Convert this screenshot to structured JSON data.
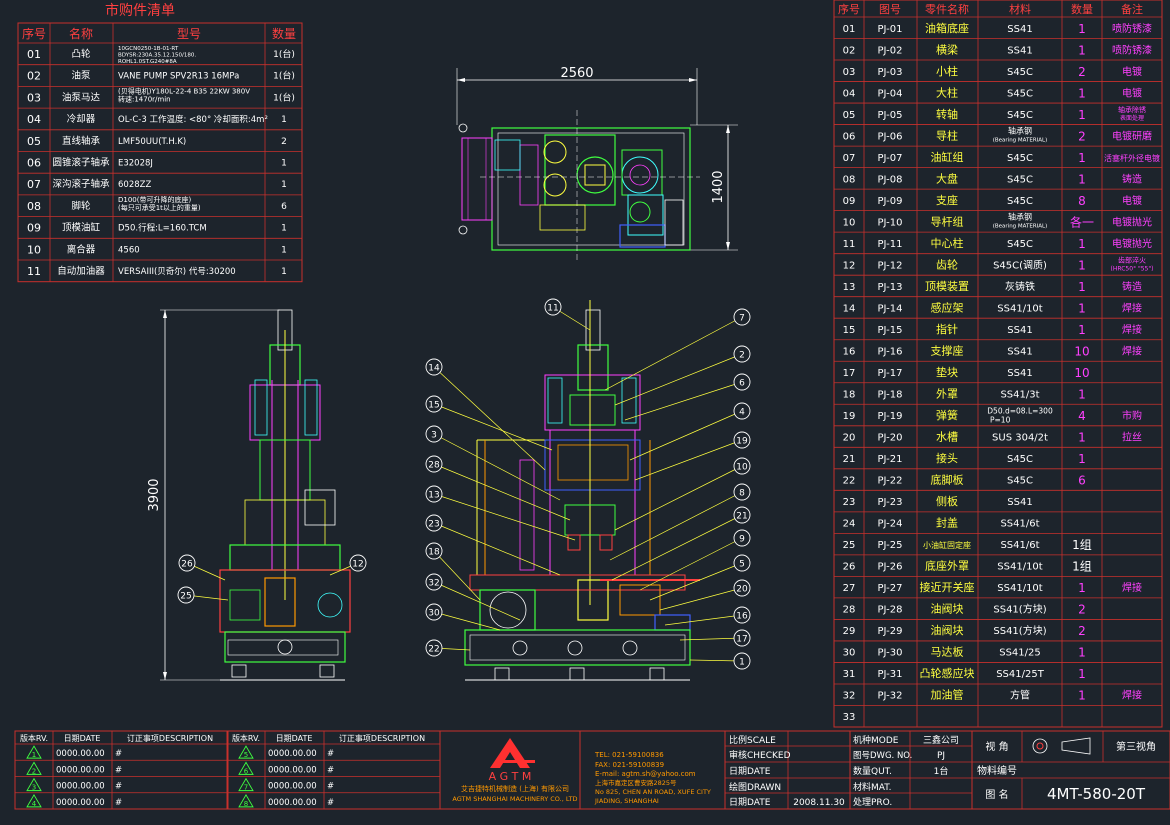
{
  "colors": {
    "bg": "#1d242c",
    "grid": "#c8302c",
    "text": "#ffffff",
    "accent_red": "#ff4040",
    "magenta": "#ff40ff",
    "yellow": "#ffff40",
    "cyan": "#40ffff",
    "green": "#40ff40",
    "blue": "#4060ff",
    "orange": "#ff9900"
  },
  "purchased_list": {
    "title": "市购件清单",
    "headers": [
      "序号",
      "名称",
      "型号",
      "数量"
    ],
    "rows": [
      {
        "no": "01",
        "name": "凸轮",
        "model": "10GCN0250-1B-01-RT / BDYSR:230A.35.12.150/180. / ROHL1.0ST.G240#8A",
        "qty": "1(台)"
      },
      {
        "no": "02",
        "name": "油泵",
        "model": "VANE PUMP  SPV2R13  16MPa",
        "qty": "1(台)"
      },
      {
        "no": "03",
        "name": "油泵马达",
        "model": "(贝得电机)Y180L-22-4 B35 22KW 380V / 转速:1470r/min",
        "qty": "1(台)"
      },
      {
        "no": "04",
        "name": "冷却器",
        "model": "OL-C-3 工作温度: <80°  冷却面积:4m²",
        "qty": "1"
      },
      {
        "no": "05",
        "name": "直线轴承",
        "model": "LMF50UU(T.H.K)",
        "qty": "2"
      },
      {
        "no": "06",
        "name": "圆锥滚子轴承",
        "model": "E32028J",
        "qty": "1"
      },
      {
        "no": "07",
        "name": "深沟滚子轴承",
        "model": "6028ZZ",
        "qty": "1"
      },
      {
        "no": "08",
        "name": "脚轮",
        "model": "D100(带可升降的底座) / (每只可承受1t以上的重量)",
        "qty": "6"
      },
      {
        "no": "09",
        "name": "顶模油缸",
        "model": "D50.行程:L=160.TCM",
        "qty": "1"
      },
      {
        "no": "10",
        "name": "离合器",
        "model": "4560",
        "qty": "1"
      },
      {
        "no": "11",
        "name": "自动加油器",
        "model": "VERSAIII(贝奇尔) 代号:30200",
        "qty": "1"
      }
    ]
  },
  "parts_list": {
    "headers": [
      "序号",
      "图号",
      "零件名称",
      "材料",
      "数量",
      "备注"
    ],
    "rows": [
      {
        "no": "01",
        "code": "PJ-01",
        "name": "油箱底座",
        "mat": "SS41",
        "qty": "1",
        "note": "喷防锈漆"
      },
      {
        "no": "02",
        "code": "PJ-02",
        "name": "横梁",
        "mat": "SS41",
        "qty": "1",
        "note": "喷防锈漆"
      },
      {
        "no": "03",
        "code": "PJ-03",
        "name": "小柱",
        "mat": "S45C",
        "qty": "2",
        "note": "电镀"
      },
      {
        "no": "04",
        "code": "PJ-04",
        "name": "大柱",
        "mat": "S45C",
        "qty": "1",
        "note": "电镀"
      },
      {
        "no": "05",
        "code": "PJ-05",
        "name": "转轴",
        "mat": "S45C",
        "qty": "1",
        "note": "轴承除锈 表面处理"
      },
      {
        "no": "06",
        "code": "PJ-06",
        "name": "导柱",
        "mat": "轴承钢 (Bearing MATERIAL)",
        "qty": "2",
        "note": "电镀研磨"
      },
      {
        "no": "07",
        "code": "PJ-07",
        "name": "油缸组",
        "mat": "S45C",
        "qty": "1",
        "note": "活塞杆外径电镀"
      },
      {
        "no": "08",
        "code": "PJ-08",
        "name": "大盘",
        "mat": "S45C",
        "qty": "1",
        "note": "铸造"
      },
      {
        "no": "09",
        "code": "PJ-09",
        "name": "支座",
        "mat": "S45C",
        "qty": "8",
        "note": "电镀"
      },
      {
        "no": "10",
        "code": "PJ-10",
        "name": "导杆组",
        "mat": "轴承钢 (Bearing MATERIAL)",
        "qty": "各一",
        "note": "电镀抛光"
      },
      {
        "no": "11",
        "code": "PJ-11",
        "name": "中心柱",
        "mat": "S45C",
        "qty": "1",
        "note": "电镀抛光"
      },
      {
        "no": "12",
        "code": "PJ-12",
        "name": "齿轮",
        "mat": "S45C(调质)",
        "qty": "1",
        "note": "齿部淬火 (HRC50° \"55\")"
      },
      {
        "no": "13",
        "code": "PJ-13",
        "name": "顶模装置",
        "mat": "灰铸铁",
        "qty": "1",
        "note": "铸造"
      },
      {
        "no": "14",
        "code": "PJ-14",
        "name": "感应架",
        "mat": "SS41/10t",
        "qty": "1",
        "note": "焊接"
      },
      {
        "no": "15",
        "code": "PJ-15",
        "name": "指针",
        "mat": "SS41",
        "qty": "1",
        "note": "焊接"
      },
      {
        "no": "16",
        "code": "PJ-16",
        "name": "支撑座",
        "mat": "SS41",
        "qty": "10",
        "note": "焊接"
      },
      {
        "no": "17",
        "code": "PJ-17",
        "name": "垫块",
        "mat": "SS41",
        "qty": "10",
        "note": ""
      },
      {
        "no": "18",
        "code": "PJ-18",
        "name": "外罩",
        "mat": "SS41/3t",
        "qty": "1",
        "note": ""
      },
      {
        "no": "19",
        "code": "PJ-19",
        "name": "弹簧",
        "mat": "D50.d=08.L=300 P=10",
        "qty": "4",
        "note": "市购"
      },
      {
        "no": "20",
        "code": "PJ-20",
        "name": "水槽",
        "mat": "SUS 304/2t",
        "qty": "1",
        "note": "拉丝"
      },
      {
        "no": "21",
        "code": "PJ-21",
        "name": "接头",
        "mat": "S45C",
        "qty": "1",
        "note": ""
      },
      {
        "no": "22",
        "code": "PJ-22",
        "name": "底脚板",
        "mat": "S45C",
        "qty": "6",
        "note": ""
      },
      {
        "no": "23",
        "code": "PJ-23",
        "name": "侧板",
        "mat": "SS41",
        "qty": "",
        "note": ""
      },
      {
        "no": "24",
        "code": "PJ-24",
        "name": "封盖",
        "mat": "SS41/6t",
        "qty": "",
        "note": ""
      },
      {
        "no": "25",
        "code": "PJ-25",
        "name": "小油缸固定座",
        "mat": "SS41/6t",
        "qty": "1组",
        "note": ""
      },
      {
        "no": "26",
        "code": "PJ-26",
        "name": "底座外罩",
        "mat": "SS41/10t",
        "qty": "1组",
        "note": ""
      },
      {
        "no": "27",
        "code": "PJ-27",
        "name": "接近开关座",
        "mat": "SS41/10t",
        "qty": "1",
        "note": "焊接"
      },
      {
        "no": "28",
        "code": "PJ-28",
        "name": "油阀块",
        "mat": "SS41(方块)",
        "qty": "2",
        "note": ""
      },
      {
        "no": "29",
        "code": "PJ-29",
        "name": "油阀块",
        "mat": "SS41(方块)",
        "qty": "2",
        "note": ""
      },
      {
        "no": "30",
        "code": "PJ-30",
        "name": "马达板",
        "mat": "SS41/25",
        "qty": "1",
        "note": ""
      },
      {
        "no": "31",
        "code": "PJ-31",
        "name": "凸轮感应块",
        "mat": "SS41/25T",
        "qty": "1",
        "note": ""
      },
      {
        "no": "32",
        "code": "PJ-32",
        "name": "加油管",
        "mat": "方管",
        "qty": "1",
        "note": "焊接"
      },
      {
        "no": "33",
        "code": "",
        "name": "",
        "mat": "",
        "qty": "",
        "note": ""
      }
    ]
  },
  "dimensions": {
    "width": "2560",
    "depth": "1400",
    "height": "3900"
  },
  "balloons": {
    "side_view": [
      "26",
      "25",
      "12"
    ],
    "front_view": [
      "11",
      "7",
      "14",
      "2",
      "15",
      "6",
      "3",
      "4",
      "28",
      "19",
      "13",
      "10",
      "23",
      "8",
      "18",
      "21",
      "32",
      "9",
      "30",
      "5",
      "22",
      "20",
      "16",
      "17",
      "1"
    ]
  },
  "revision_block": {
    "headers": [
      "版本RV.",
      "日期DATE",
      "订正事项DESCRIPTION"
    ],
    "rows": [
      {
        "rev": "1",
        "date": "0000.00.00",
        "desc": "#"
      },
      {
        "rev": "2",
        "date": "0000.00.00",
        "desc": "#"
      },
      {
        "rev": "3",
        "date": "0000.00.00",
        "desc": "#"
      },
      {
        "rev": "4",
        "date": "0000.00.00",
        "desc": "#"
      }
    ],
    "rows_right": [
      {
        "rev": "5",
        "date": "0000.00.00",
        "desc": "#"
      },
      {
        "rev": "6",
        "date": "0000.00.00",
        "desc": "#"
      },
      {
        "rev": "7",
        "date": "0000.00.00",
        "desc": "#"
      },
      {
        "rev": "8",
        "date": "0000.00.00",
        "desc": "#"
      }
    ]
  },
  "company": {
    "logo_text": "A G T M",
    "name_cn": "艾吉捷特机械制造 (上海) 有限公司",
    "name_en": "AGTM SHANGHAI MACHINERY CO., LTD",
    "tel": "TEL: 021-59100836",
    "fax": "FAX: 021-59100839",
    "email": "E-mail: agtm.sh@yahoo.com",
    "addr_cn": "上海市嘉定区曹安路2825号",
    "addr_en1": "No 825, CHEN AN ROAD, XUFE CITY",
    "addr_en2": "JIADING, SHANGHAI"
  },
  "title_block": {
    "scale_label": "比例SCALE",
    "checked_label": "审核CHECKED",
    "date_label": "日期DATE",
    "drawn_label": "绘图DRAWN",
    "date2_label": "日期DATE",
    "date_value": "2008.11.30",
    "mode_label": "机种MODE",
    "mode_value": "三鑫公司",
    "dwg_label": "图号DWG. NO.",
    "dwg_value": "PJ",
    "qty_label": "数量QUT.",
    "qty_value": "1台",
    "mat_label": "材料MAT.",
    "pro_label": "处理PRO.",
    "view_label": "视  角",
    "third_angle": "第三视角",
    "material_no": "物料编号",
    "drawing_name_label": "图  名",
    "drawing_name": "4MT-580-20T"
  }
}
